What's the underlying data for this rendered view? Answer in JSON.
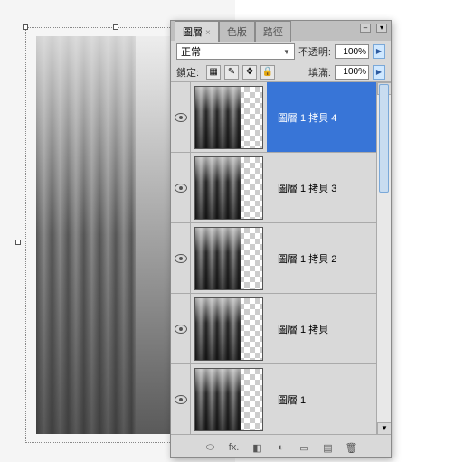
{
  "tabs": {
    "layers": "圖層",
    "channels": "色版",
    "paths": "路徑"
  },
  "blend": {
    "mode": "正常",
    "opacity_label": "不透明:",
    "opacity_value": "100%",
    "fill_label": "填滿:",
    "fill_value": "100%",
    "lock_label": "鎖定:"
  },
  "layers": [
    {
      "name": "圖層 1 拷貝 4",
      "selected": true
    },
    {
      "name": "圖層 1 拷貝 3",
      "selected": false
    },
    {
      "name": "圖層 1 拷貝 2",
      "selected": false
    },
    {
      "name": "圖層 1 拷貝",
      "selected": false
    },
    {
      "name": "圖層 1",
      "selected": false
    }
  ],
  "icons": {
    "link": "⬭",
    "fx": "fx.",
    "mask": "◧",
    "adjust": "◐",
    "group": "▭",
    "new": "▤",
    "trash": "🗑"
  }
}
